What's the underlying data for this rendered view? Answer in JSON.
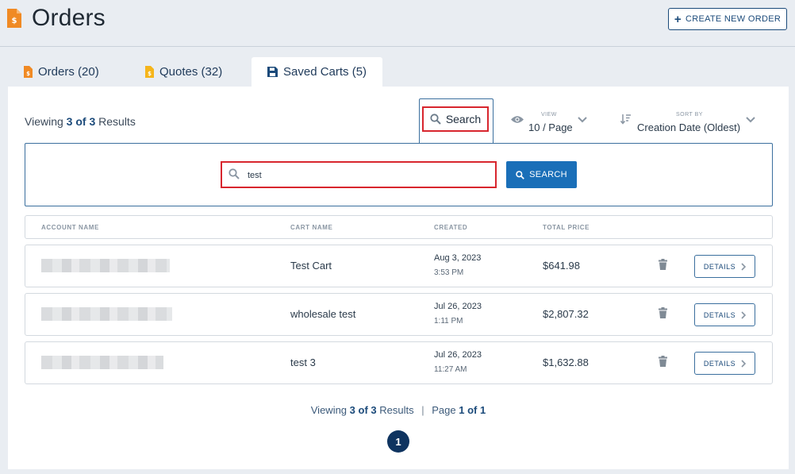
{
  "header": {
    "title": "Orders",
    "create_label": "CREATE NEW ORDER"
  },
  "tabs": [
    {
      "label": "Orders (20)",
      "icon": "order-doc-icon",
      "active": false
    },
    {
      "label": "Quotes (32)",
      "icon": "quote-doc-icon",
      "active": false
    },
    {
      "label": "Saved Carts (5)",
      "icon": "save-icon",
      "active": true
    }
  ],
  "toolbar": {
    "viewing_prefix": "Viewing",
    "viewing_shown": "3 of 3",
    "viewing_suffix": "Results",
    "search_toggle_label": "Search",
    "view_caption": "VIEW",
    "view_value": "10 / Page",
    "sort_caption": "SORT BY",
    "sort_value": "Creation Date (Oldest)"
  },
  "search": {
    "value": "test",
    "button_label": "SEARCH"
  },
  "table": {
    "columns": [
      "ACCOUNT NAME",
      "CART NAME",
      "CREATED",
      "TOTAL PRICE"
    ],
    "rows": [
      {
        "cart_name": "Test Cart",
        "created_date": "Aug 3, 2023",
        "created_time": "3:53 PM",
        "total_price": "$641.98",
        "details_label": "DETAILS"
      },
      {
        "cart_name": "wholesale test",
        "created_date": "Jul 26, 2023",
        "created_time": "1:11 PM",
        "total_price": "$2,807.32",
        "details_label": "DETAILS"
      },
      {
        "cart_name": "test 3",
        "created_date": "Jul 26, 2023",
        "created_time": "11:27 AM",
        "total_price": "$1,632.88",
        "details_label": "DETAILS"
      }
    ]
  },
  "footer": {
    "viewing_prefix": "Viewing",
    "viewing_shown": "3 of 3",
    "viewing_suffix": "Results",
    "separator": "|",
    "page_prefix": "Page",
    "page_value": "1 of 1",
    "current_page": "1"
  },
  "colors": {
    "accent": "#1a6fb8",
    "navy": "#0f3460",
    "highlight": "#d8262e",
    "orange_icon": "#f08a24",
    "yellow_icon": "#f5b51b"
  }
}
